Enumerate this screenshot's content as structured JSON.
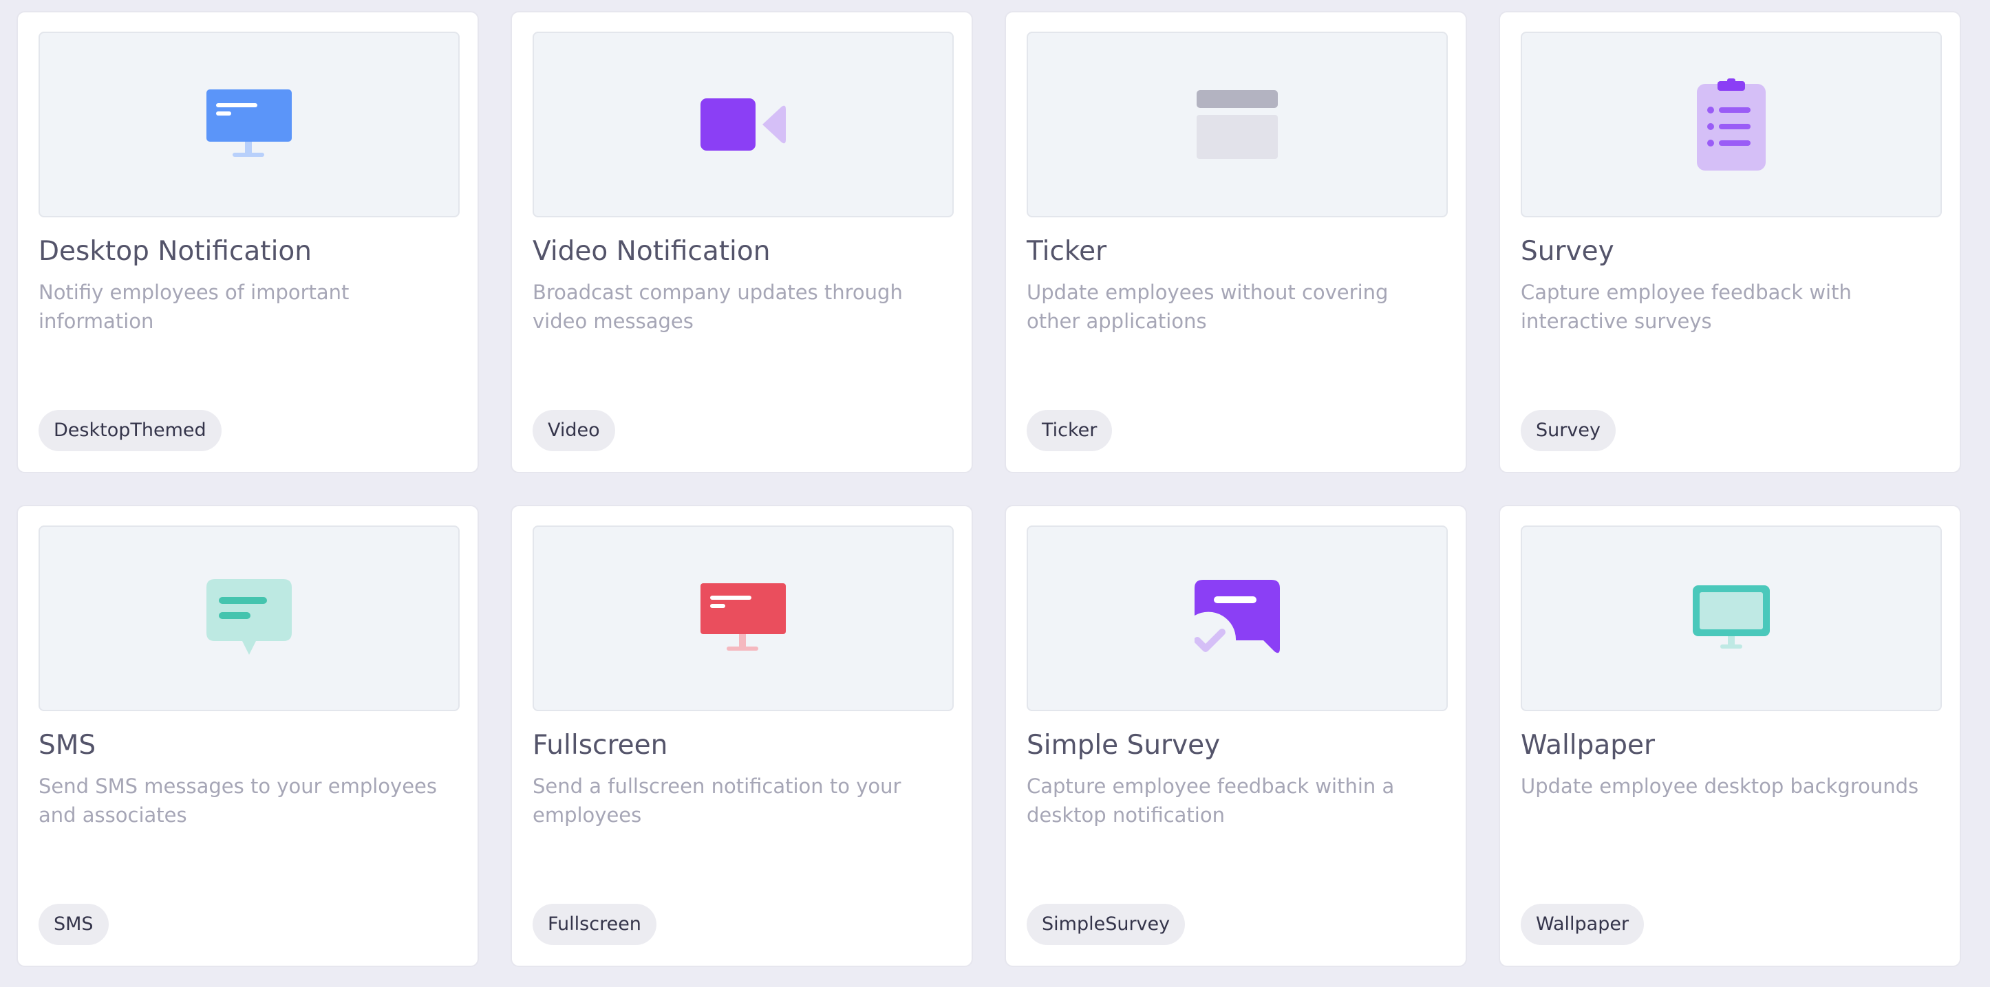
{
  "cards": [
    {
      "title": "Desktop Notification",
      "description": "Notifiy employees of important information",
      "tag": "DesktopThemed",
      "icon": "desktop-monitor-icon",
      "color": "#5b95f9"
    },
    {
      "title": "Video Notification",
      "description": "Broadcast company updates through video messages",
      "tag": "Video",
      "icon": "video-camera-icon",
      "color": "#8b3ff5"
    },
    {
      "title": "Ticker",
      "description": "Update employees without covering other applications",
      "tag": "Ticker",
      "icon": "ticker-icon",
      "color": "#b3b3c1"
    },
    {
      "title": "Survey",
      "description": "Capture employee feedback with interactive surveys",
      "tag": "Survey",
      "icon": "clipboard-icon",
      "color": "#d5bff7"
    },
    {
      "title": "SMS",
      "description": "Send SMS messages to your employees and associates",
      "tag": "SMS",
      "icon": "chat-bubble-icon",
      "color": "#44c4ae"
    },
    {
      "title": "Fullscreen",
      "description": "Send a fullscreen notification to your employees",
      "tag": "Fullscreen",
      "icon": "fullscreen-monitor-icon",
      "color": "#ea4e5d"
    },
    {
      "title": "Simple Survey",
      "description": "Capture employee feedback within a desktop notification",
      "tag": "SimpleSurvey",
      "icon": "survey-check-icon",
      "color": "#8b3ff5"
    },
    {
      "title": "Wallpaper",
      "description": "Update employee desktop backgrounds",
      "tag": "Wallpaper",
      "icon": "wallpaper-monitor-icon",
      "color": "#4ac8bb"
    }
  ]
}
